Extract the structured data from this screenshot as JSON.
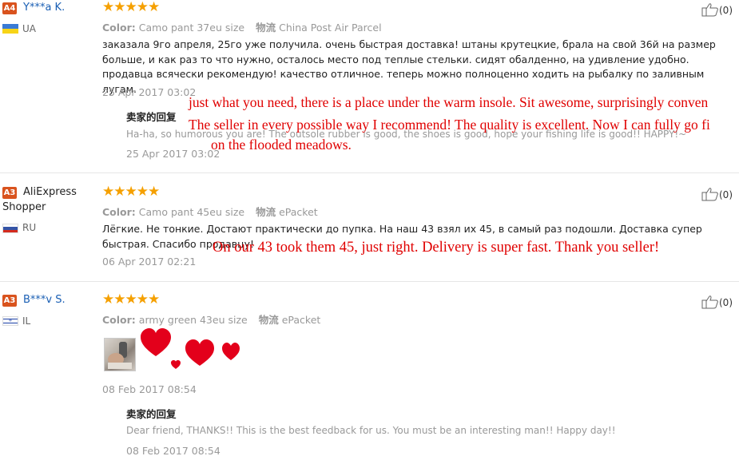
{
  "like_icon": "thumbs-up-icon",
  "colors": {
    "stars": "#f5a000",
    "badge": "#d9531e",
    "link": "#1a5fb4",
    "overlay": "#e00000"
  },
  "reviews": [
    {
      "badge": "A4",
      "user": "Y***a K.",
      "country": "UA",
      "stars": "★★★★★",
      "rating": 5,
      "color_label": "Color:",
      "color_value": "Camo pant 37eu size",
      "shipping_label": "物流",
      "shipping_value": "China Post Air Parcel",
      "text": "заказала 9го апреля, 25го уже получила. очень быстрая доставка! штаны крутецкие, брала на свой 36й на размер больше, и как раз то что нужно, осталось место под теплые стельки. сидят обалденно, на удивление удобно. продавца всячески рекомендую! качество отличное. теперь можно полноценно ходить на рыбалку по заливным лугам.",
      "date": "25 Apr 2017 03:02",
      "likes": "(0)",
      "seller_title": "卖家的回复",
      "seller_reply": "Ha-ha, so humorous you are! The outsole rubber is good, the shoes is good, hope your fishing life is good!! HAPPY!~",
      "seller_date": "25 Apr 2017 03:02",
      "overlay": [
        "just what you need, there is a place under the warm insole. Sit awesome, surprisingly conven",
        "The seller in every possible way I recommend! The quality is excellent. Now I can fully go fi",
        "on the flooded meadows."
      ]
    },
    {
      "badge": "A3",
      "user_line1": "AliExpress",
      "user_line2": "Shopper",
      "country": "RU",
      "stars": "★★★★★",
      "rating": 5,
      "color_label": "Color:",
      "color_value": "Camo pant 45eu size",
      "shipping_label": "物流",
      "shipping_value": "ePacket",
      "text": "Лёгкие. Не тонкие. Достают практически до пупка. На наш 43 взял их 45, в самый раз подошли. Доставка супер быстрая. Спасибо продавцу!",
      "date": "06 Apr 2017 02:21",
      "likes": "(0)",
      "overlay": "On our 43 took them 45, just right. Delivery is super fast. Thank you seller!"
    },
    {
      "badge": "A3",
      "user": "B***v S.",
      "country": "IL",
      "stars": "★★★★★",
      "rating": 5,
      "color_label": "Color:",
      "color_value": "army green 43eu size",
      "shipping_label": "物流",
      "shipping_value": "ePacket",
      "date": "08 Feb 2017 08:54",
      "likes": "(0)",
      "seller_title": "卖家的回复",
      "seller_reply": "Dear friend, THANKS!! This is the best feedback for us. You must be an interesting man!! Happy day!!",
      "seller_date": "08 Feb 2017 08:54"
    }
  ]
}
